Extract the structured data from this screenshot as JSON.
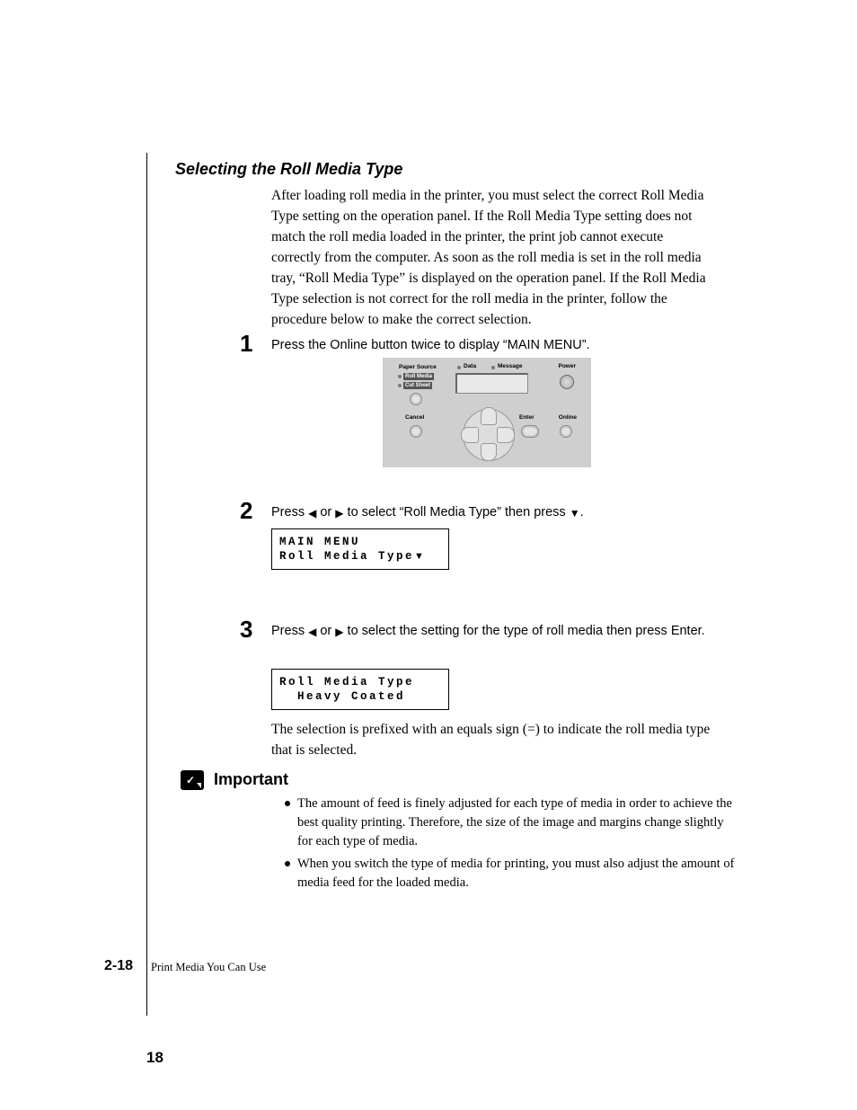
{
  "section_title": "Selecting the Roll Media Type",
  "intro": "After loading roll media in the printer, you must select the correct Roll Media Type setting on the operation panel. If the Roll Media Type setting does not match the roll media loaded in the printer, the print job cannot execute correctly from the computer. As soon as the roll media is set in the roll media tray, “Roll Media Type” is displayed on the operation panel. If the Roll Media Type selection is not correct for the roll media in the printer, follow the procedure below to make the correct selection.",
  "steps": {
    "s1": {
      "num": "1",
      "text": "Press the Online button twice to display “MAIN MENU”."
    },
    "s2": {
      "num": "2",
      "pre": "Press ",
      "mid1": " or ",
      "mid2": " to select “Roll Media Type” then press ",
      "post": "."
    },
    "s3": {
      "num": "3",
      "pre": "Press ",
      "mid1": " or ",
      "mid2": " to select the setting for the type of roll media then press Enter."
    }
  },
  "panel": {
    "paper_source": "Paper Source",
    "roll_media": "Roll Media",
    "cut_sheet": "Cut Sheet",
    "data": "Data",
    "message": "Message",
    "power": "Power",
    "cancel": "Cancel",
    "enter": "Enter",
    "online": "Online"
  },
  "lcd1_line1": "MAIN MENU",
  "lcd1_line2": "Roll Media Type",
  "lcd2_line1": "Roll Media Type",
  "lcd2_line2": "  Heavy Coated",
  "after_lcd": "The selection is prefixed with an equals sign (=) to indicate the roll media type that is selected.",
  "important_label": "Important",
  "important_items": [
    "The amount of feed is finely adjusted for each type of media in order to achieve the best quality printing. Therefore, the size of the image and margins change slightly for each type of media.",
    "When you switch the type of media for printing, you must also adjust the amount of media feed for the loaded media."
  ],
  "footer": {
    "code": "2-18",
    "section": "Print Media You Can Use",
    "pagenum": "18"
  }
}
